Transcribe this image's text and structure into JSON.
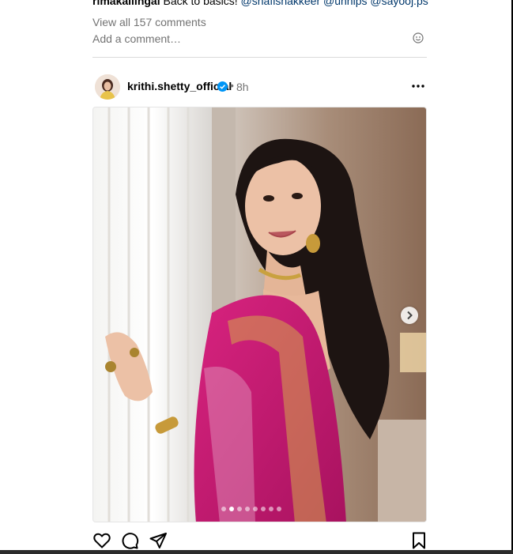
{
  "previous_post": {
    "caption_user": "rimakallingal",
    "caption_text": "Back to basics!",
    "caption_tags": "@shafishakkeer @unnips @sayooj.ps",
    "view_comments": "View all 157 comments",
    "add_comment_placeholder": "Add a comment…"
  },
  "post": {
    "username": "krithi.shetty_official",
    "verified": true,
    "separator": "•",
    "time_ago": "8h",
    "carousel_count": 8,
    "carousel_active_index": 1
  },
  "icons": {
    "emoji": "emoji-icon",
    "verified": "verified-badge-icon",
    "more": "more-options-icon",
    "next": "chevron-right-icon",
    "like": "heart-icon",
    "comment": "comment-icon",
    "share": "paper-plane-icon",
    "save": "bookmark-icon"
  },
  "colors": {
    "verified_badge": "#0095f6",
    "muted_text": "#737373",
    "link": "#00376b",
    "saree": "#c7197d"
  }
}
